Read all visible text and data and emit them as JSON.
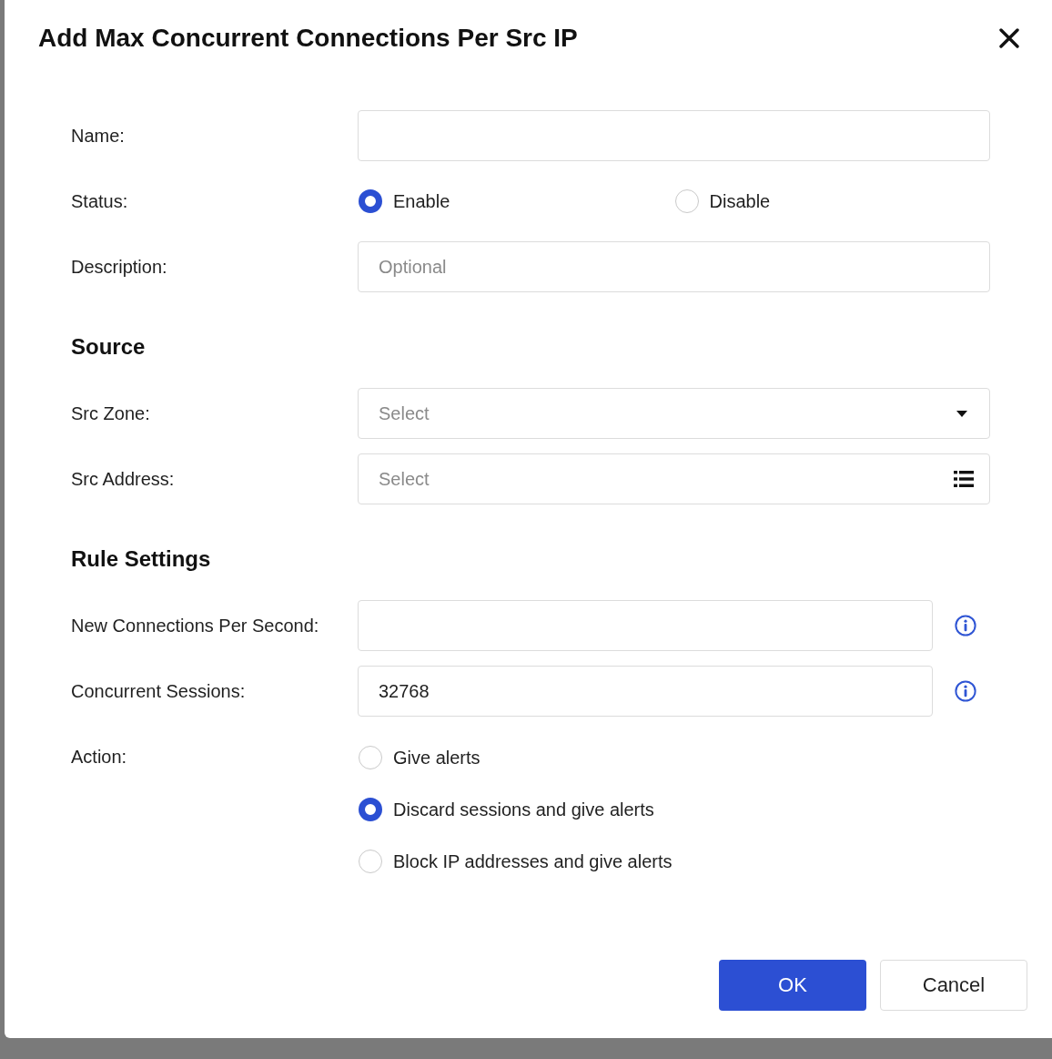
{
  "dialog": {
    "title": "Add Max Concurrent Connections Per Src IP"
  },
  "form": [
    {
      "kind": "input",
      "label": "Name:"
    },
    {
      "kind": "radio",
      "label": "Status:",
      "options": [
        {
          "label": "Enable",
          "selected": true
        },
        {
          "label": "Disable",
          "selected": false
        }
      ]
    },
    {
      "kind": "input",
      "label": "Description:",
      "placeholder": "Optional"
    },
    {
      "kind": "heading",
      "text": "Source"
    },
    {
      "kind": "select",
      "label": "Src Zone:",
      "placeholder": "Select"
    },
    {
      "kind": "picker",
      "label": "Src Address:",
      "placeholder": "Select"
    },
    {
      "kind": "heading",
      "text": "Rule Settings"
    },
    {
      "kind": "input",
      "label": "New Connections Per Second:",
      "info": true
    },
    {
      "kind": "input",
      "label": "Concurrent Sessions:",
      "value": "32768",
      "info": true
    },
    {
      "kind": "radio-list",
      "label": "Action:",
      "options": [
        {
          "label": "Give alerts",
          "selected": false
        },
        {
          "label": "Discard sessions and give alerts",
          "selected": true
        },
        {
          "label": "Block IP addresses and give alerts",
          "selected": false
        }
      ]
    }
  ],
  "buttons": [
    {
      "label": "OK",
      "kind": "primary"
    },
    {
      "label": "Cancel",
      "kind": "secondary"
    }
  ]
}
